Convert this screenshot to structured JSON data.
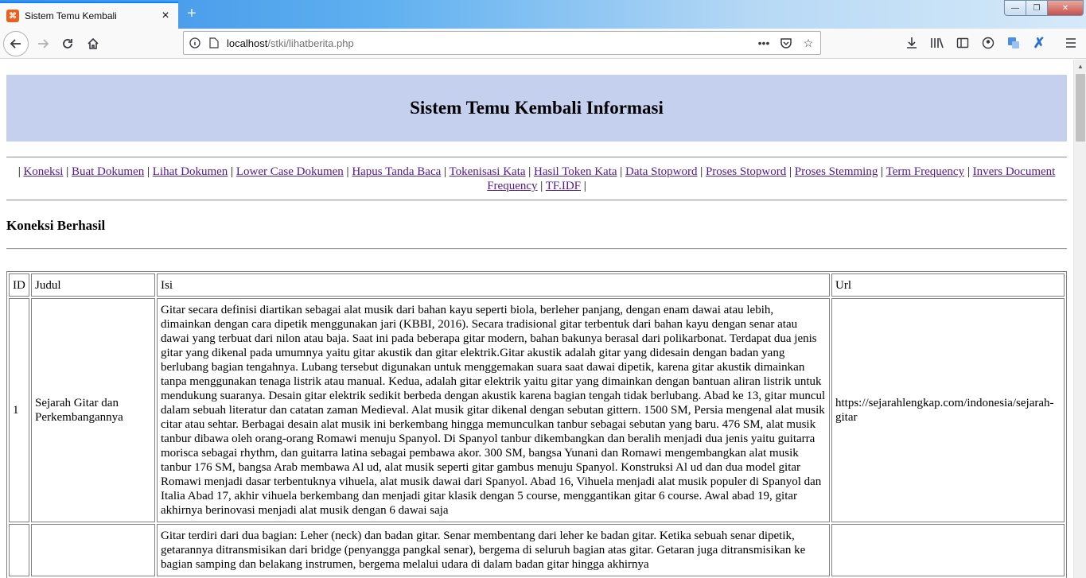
{
  "browser": {
    "tab_title": "Sistem Temu Kembali",
    "url_host": "localhost",
    "url_path": "/stki/lihatberita.php"
  },
  "page": {
    "banner_title": "Sistem Temu Kembali Informasi",
    "menu": [
      "Koneksi",
      "Buat Dokumen",
      "Lihat Dokumen",
      "Lower Case Dokumen",
      "Hapus Tanda Baca",
      "Tokenisasi Kata",
      "Hasil Token Kata",
      "Data Stopword",
      "Proses Stopword",
      "Proses Stemming",
      "Term Frequency",
      "Invers Document Frequency",
      "TF.IDF"
    ],
    "status": "Koneksi Berhasil",
    "table": {
      "headers": [
        "ID",
        "Judul",
        "Isi",
        "Url"
      ],
      "rows": [
        {
          "id": "1",
          "judul": "Sejarah Gitar dan Perkembangannya",
          "isi": "Gitar secara definisi diartikan sebagai alat musik dari bahan kayu seperti biola, berleher panjang, dengan enam dawai atau lebih, dimainkan dengan cara dipetik menggunakan jari (KBBI, 2016). Secara tradisional gitar terbentuk dari bahan kayu dengan senar atau dawai yang terbuat dari nilon atau baja. Saat ini pada beberapa gitar modern, bahan bakunya berasal dari polikarbonat. Terdapat dua jenis gitar yang dikenal pada umumnya yaitu gitar akustik dan gitar elektrik.Gitar akustik adalah gitar yang didesain dengan badan yang berlubang bagian tengahnya. Lubang tersebut digunakan untuk menggemakan suara saat dawai dipetik, karena gitar akustik dimainkan tanpa menggunakan tenaga listrik atau manual. Kedua, adalah gitar elektrik yaitu gitar yang dimainkan dengan bantuan aliran listrik untuk mendukung suaranya. Desain gitar elektrik sedikit berbeda dengan akustik karena bagian tengah tidak berlubang. Abad ke 13, gitar muncul dalam sebuah literatur dan catatan zaman Medieval. Alat musik gitar dikenal dengan sebutan gittern. 1500 SM, Persia mengenal alat musik citar atau sehtar. Berbagai desain alat musik ini berkembang hingga memunculkan tanbur sebagai sebutan yang baru. 476 SM, alat musik tanbur dibawa oleh orang-orang Romawi menuju Spanyol. Di Spanyol tanbur dikembangkan dan beralih menjadi dua jenis yaitu guitarra morisca sebagai rhythm, dan guitarra latina sebagai pembawa akor. 300 SM, bangsa Yunani dan Romawi mengembangkan alat musik tanbur 176 SM, bangsa Arab membawa Al ud, alat musik seperti gitar gambus menuju Spanyol. Konstruksi Al ud dan dua model gitar Romawi menjadi dasar terbentuknya vihuela, alat musik dawai dari Spanyol. Abad 16, Vihuela menjadi alat musik populer di Spanyol dan Italia Abad 17, akhir vihuela berkembang dan menjadi gitar klasik dengan 5 course, menggantikan gitar 6 course. Awal abad 19, gitar akhirnya berinovasi menjadi alat musik dengan 6 dawai saja",
          "url": "https://sejarahlengkap.com/indonesia/sejarah-gitar"
        },
        {
          "id": "",
          "judul": "",
          "isi": "Gitar terdiri dari dua bagian: Leher (neck) dan badan gitar. Senar membentang dari leher ke badan gitar. Ketika sebuah senar dipetik, getarannya ditransmisikan dari bridge (penyangga pangkal senar), bergema di seluruh bagian atas gitar. Getaran juga ditransmisikan ke bagian samping dan belakang instrumen, bergema melalui udara di dalam badan gitar hingga akhirnya",
          "url": ""
        }
      ]
    }
  }
}
